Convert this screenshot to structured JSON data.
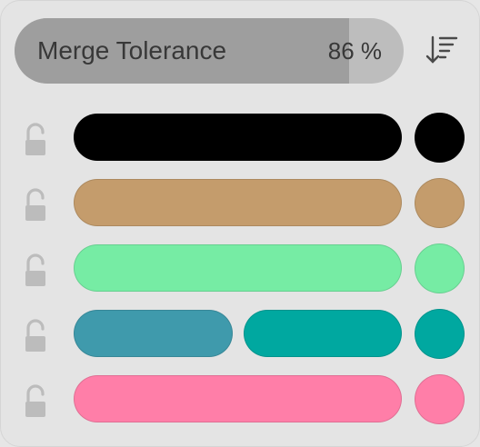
{
  "slider": {
    "label": "Merge Tolerance",
    "value_text": "86 %",
    "value": 0.86,
    "fill_color": "#9e9e9e",
    "track_color": "#bdbdbd"
  },
  "sort_button": {
    "icon": "sort-descending-icon"
  },
  "rows": [
    {
      "locked": false,
      "segments": [
        {
          "color": "#000000"
        }
      ],
      "swatch": "#000000"
    },
    {
      "locked": false,
      "segments": [
        {
          "color": "#c49c6c"
        }
      ],
      "swatch": "#c49c6c"
    },
    {
      "locked": false,
      "segments": [
        {
          "color": "#76eca4"
        }
      ],
      "swatch": "#76eca4"
    },
    {
      "locked": false,
      "segments": [
        {
          "color": "#3f9aac"
        },
        {
          "color": "#00a8a0"
        }
      ],
      "swatch": "#00a8a0"
    },
    {
      "locked": false,
      "segments": [
        {
          "color": "#ff7ea8"
        }
      ],
      "swatch": "#ff7ea8"
    }
  ]
}
